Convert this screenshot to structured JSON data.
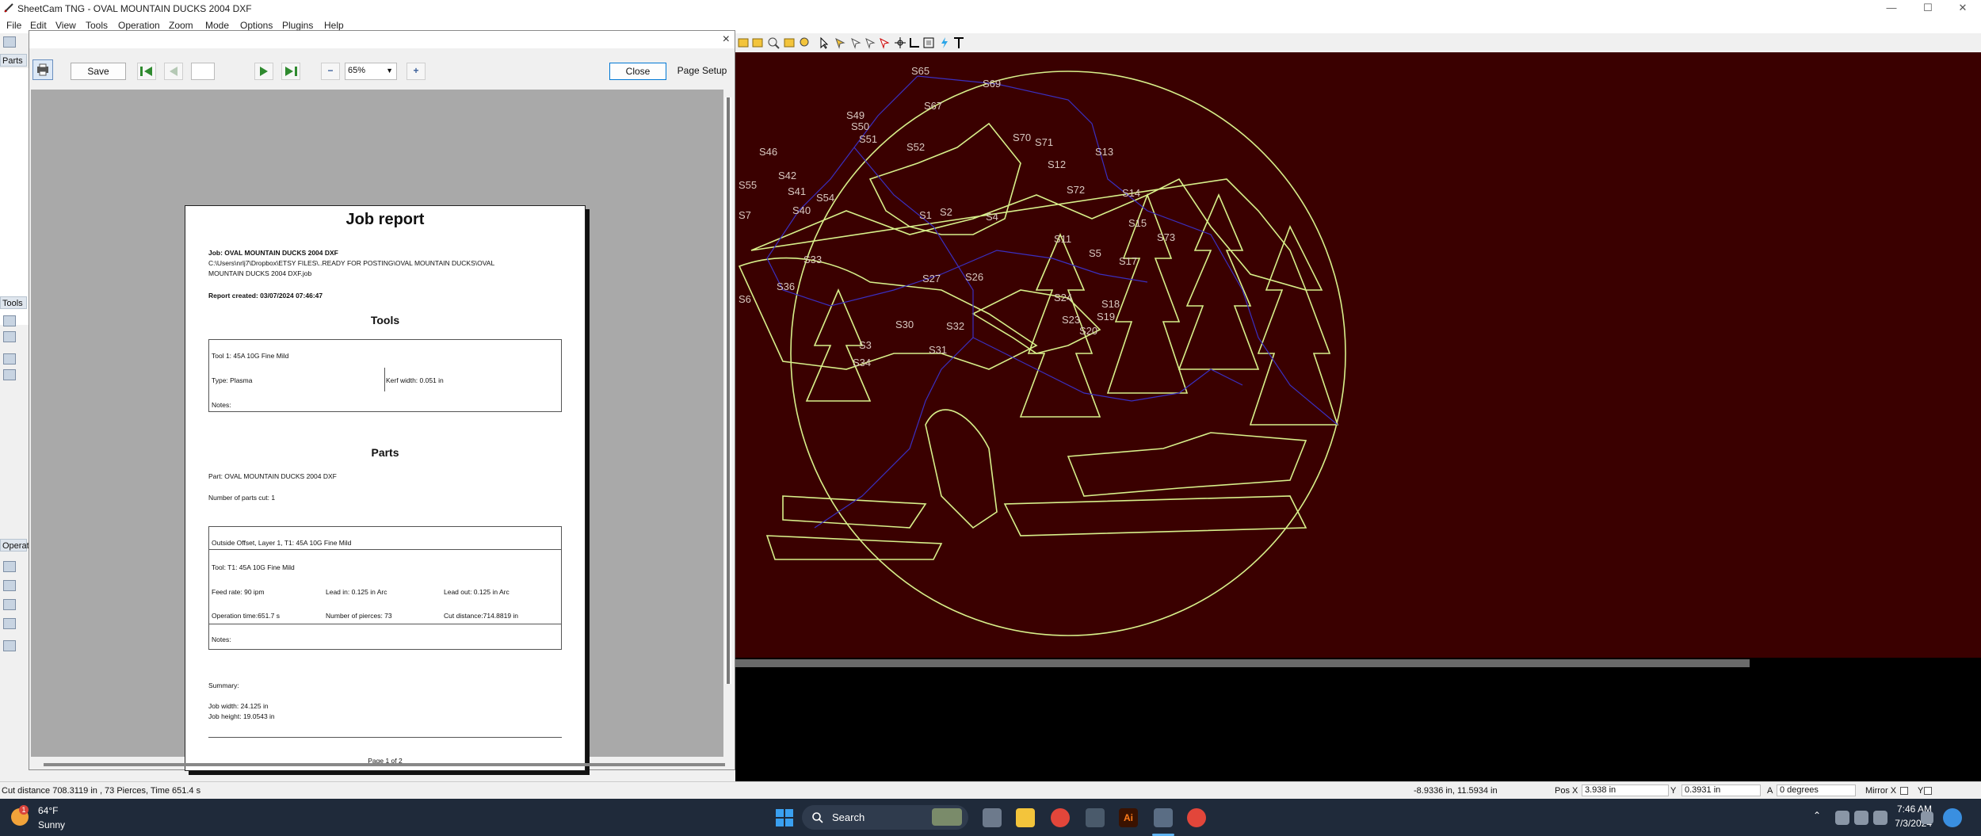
{
  "app": {
    "title": "SheetCam TNG - OVAL MOUNTAIN DUCKS 2004 DXF"
  },
  "window_controls": {
    "minimize": "—",
    "maximize": "☐",
    "close": "✕"
  },
  "menu": [
    "File",
    "Edit",
    "View",
    "Tools",
    "Operation",
    "Zoom",
    "Mode",
    "Options",
    "Plugins",
    "Help"
  ],
  "side_panels": {
    "parts_tab": "Parts",
    "tools_tab": "Tools",
    "operations_tab": "Operat"
  },
  "dialog": {
    "close_x": "×",
    "save_label": "Save",
    "page_value": "",
    "zoom_value": "65%",
    "zoom_minus": "−",
    "zoom_plus": "+",
    "close_label": "Close",
    "page_setup_label": "Page Setup"
  },
  "report": {
    "title": "Job report",
    "job_line": "Job: OVAL MOUNTAIN DUCKS 2004 DXF",
    "path_line1": "C:\\Users\\nrlj7\\Dropbox\\ETSY FILES\\..READY FOR POSTING\\OVAL MOUNTAIN DUCKS\\OVAL",
    "path_line2": "MOUNTAIN DUCKS 2004 DXF.job",
    "created": "Report created: 03/07/2024 07:46:47",
    "tools_heading": "Tools",
    "tool1_name": "Tool 1: 45A 10G Fine Mild",
    "tool1_type": "Type: Plasma",
    "tool1_kerf": "Kerf width: 0.051 in",
    "tool1_notes": "Notes:",
    "parts_heading": "Parts",
    "part_line": "Part: OVAL MOUNTAIN DUCKS 2004 DXF",
    "parts_cut": "Number of parts cut: 1",
    "op_header": "Outside Offset, Layer 1, T1: 45A 10G Fine Mild",
    "op_tool": "Tool: T1: 45A 10G Fine Mild",
    "feed_rate": "Feed rate: 90 ipm",
    "lead_in": "Lead in: 0.125 in Arc",
    "lead_out": "Lead out: 0.125 in Arc",
    "op_time": "Operation time:651.7 s",
    "pierces": "Number of pierces: 73",
    "cut_distance": "Cut distance:714.8819 in",
    "op_notes": "Notes:",
    "summary": "Summary:",
    "job_width": "Job width: 24.125 in",
    "job_height": "Job height: 19.0543 in",
    "page_footer": "Page 1 of 2"
  },
  "cad_labels": [
    "S65",
    "S69",
    "S67",
    "S49",
    "S50",
    "S51",
    "S52",
    "S70",
    "S71",
    "S13",
    "S12",
    "S46",
    "S42",
    "S55",
    "S41",
    "S54",
    "S72",
    "S14",
    "S40",
    "S1",
    "S2",
    "S4",
    "S15",
    "S73",
    "S5",
    "S11",
    "S33",
    "S27",
    "S26",
    "S17",
    "S36",
    "S24",
    "S18",
    "S30",
    "S32",
    "S23",
    "S19",
    "S20",
    "S31",
    "S3",
    "S34",
    "S7",
    "S6"
  ],
  "status": {
    "cut_info": "Cut distance 708.3119 in , 73 Pierces, Time 651.4 s",
    "cursor_pos": "-8.9336 in, 11.5934 in",
    "pos_x_label": "Pos X",
    "pos_x_value": "3.938 in",
    "y_label": "Y",
    "y_value": "0.3931 in",
    "a_label": "A",
    "a_value": "0 degrees",
    "mirror_x": "Mirror X",
    "mirror_y": "Y"
  },
  "taskbar": {
    "temperature": "64°F",
    "weather": "Sunny",
    "weather_badge": "1",
    "search_label": "Search",
    "time": "7:46 AM",
    "date": "7/3/2024"
  },
  "colors": {
    "cad_background": "#3a0000",
    "cut_path": "#d8f08a",
    "rapid_path": "#3a2fc0",
    "taskbar": "#1f2a3a"
  }
}
